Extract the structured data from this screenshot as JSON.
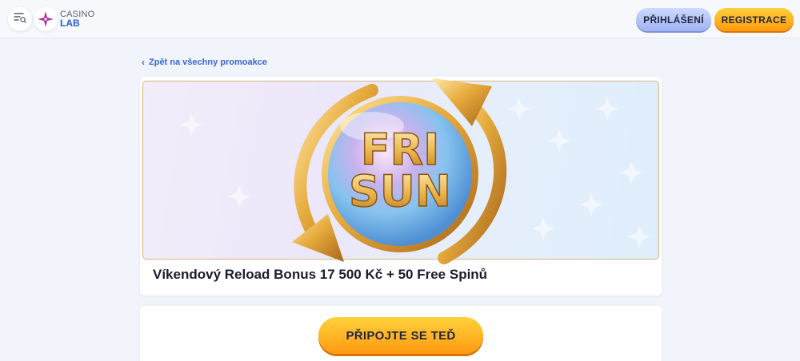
{
  "header": {
    "menu_icon": "menu-search-icon",
    "logo": {
      "line1": "CASINO",
      "line2": "LAB",
      "icon": "star-logo-icon"
    },
    "login_label": "PŘIHLÁŠENÍ",
    "register_label": "REGISTRACE"
  },
  "back_link": {
    "label": "Zpět na všechny promoakce",
    "icon": "chevron-left-icon"
  },
  "promo": {
    "banner_text_line1": "FRI",
    "banner_text_line2": "SUN",
    "title": "Víkendový Reload Bonus 17 500 Kč + 50 Free Spinů"
  },
  "cta": {
    "join_label": "PŘIPOJTE SE TEĎ"
  },
  "colors": {
    "accent_blue": "#3a66d8",
    "login_button": "#afc0f6",
    "register_button": "#ffb020",
    "gold": "#d9a23a"
  }
}
